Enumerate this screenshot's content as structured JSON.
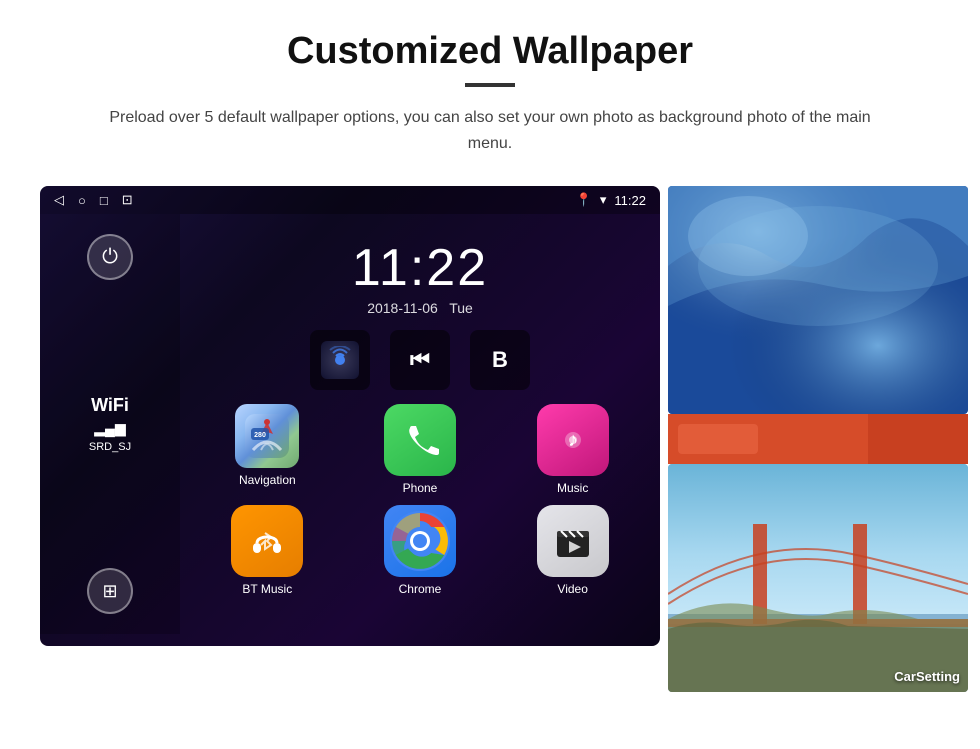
{
  "header": {
    "title": "Customized Wallpaper",
    "description": "Preload over 5 default wallpaper options, you can also set your own photo as background photo of the main menu."
  },
  "statusBar": {
    "time": "11:22",
    "icons": [
      "◁",
      "○",
      "□",
      "⊡"
    ],
    "rightIcons": [
      "📍",
      "▾"
    ]
  },
  "clock": {
    "time": "11:22",
    "date": "2018-11-06",
    "day": "Tue"
  },
  "wifi": {
    "label": "WiFi",
    "bars": "▂▄▆",
    "ssid": "SRD_SJ"
  },
  "apps": [
    {
      "name": "Navigation",
      "type": "nav",
      "icon": "🗺"
    },
    {
      "name": "Phone",
      "type": "phone",
      "icon": "📞"
    },
    {
      "name": "Music",
      "type": "music",
      "icon": "🎵"
    },
    {
      "name": "BT Music",
      "type": "bt",
      "icon": "🎧"
    },
    {
      "name": "Chrome",
      "type": "chrome",
      "icon": ""
    },
    {
      "name": "Video",
      "type": "video",
      "icon": "🎬"
    }
  ],
  "wallpapers": [
    {
      "name": "ice-cave",
      "label": "Ice Cave"
    },
    {
      "name": "bridge",
      "label": "Golden Gate Bridge"
    }
  ],
  "carSetting": {
    "label": "CarSetting"
  },
  "mediaIcons": {
    "signal": "((·))",
    "skip": "⏮",
    "b": "B"
  },
  "powerBtn": "⏻",
  "appsBtn": "⊞"
}
